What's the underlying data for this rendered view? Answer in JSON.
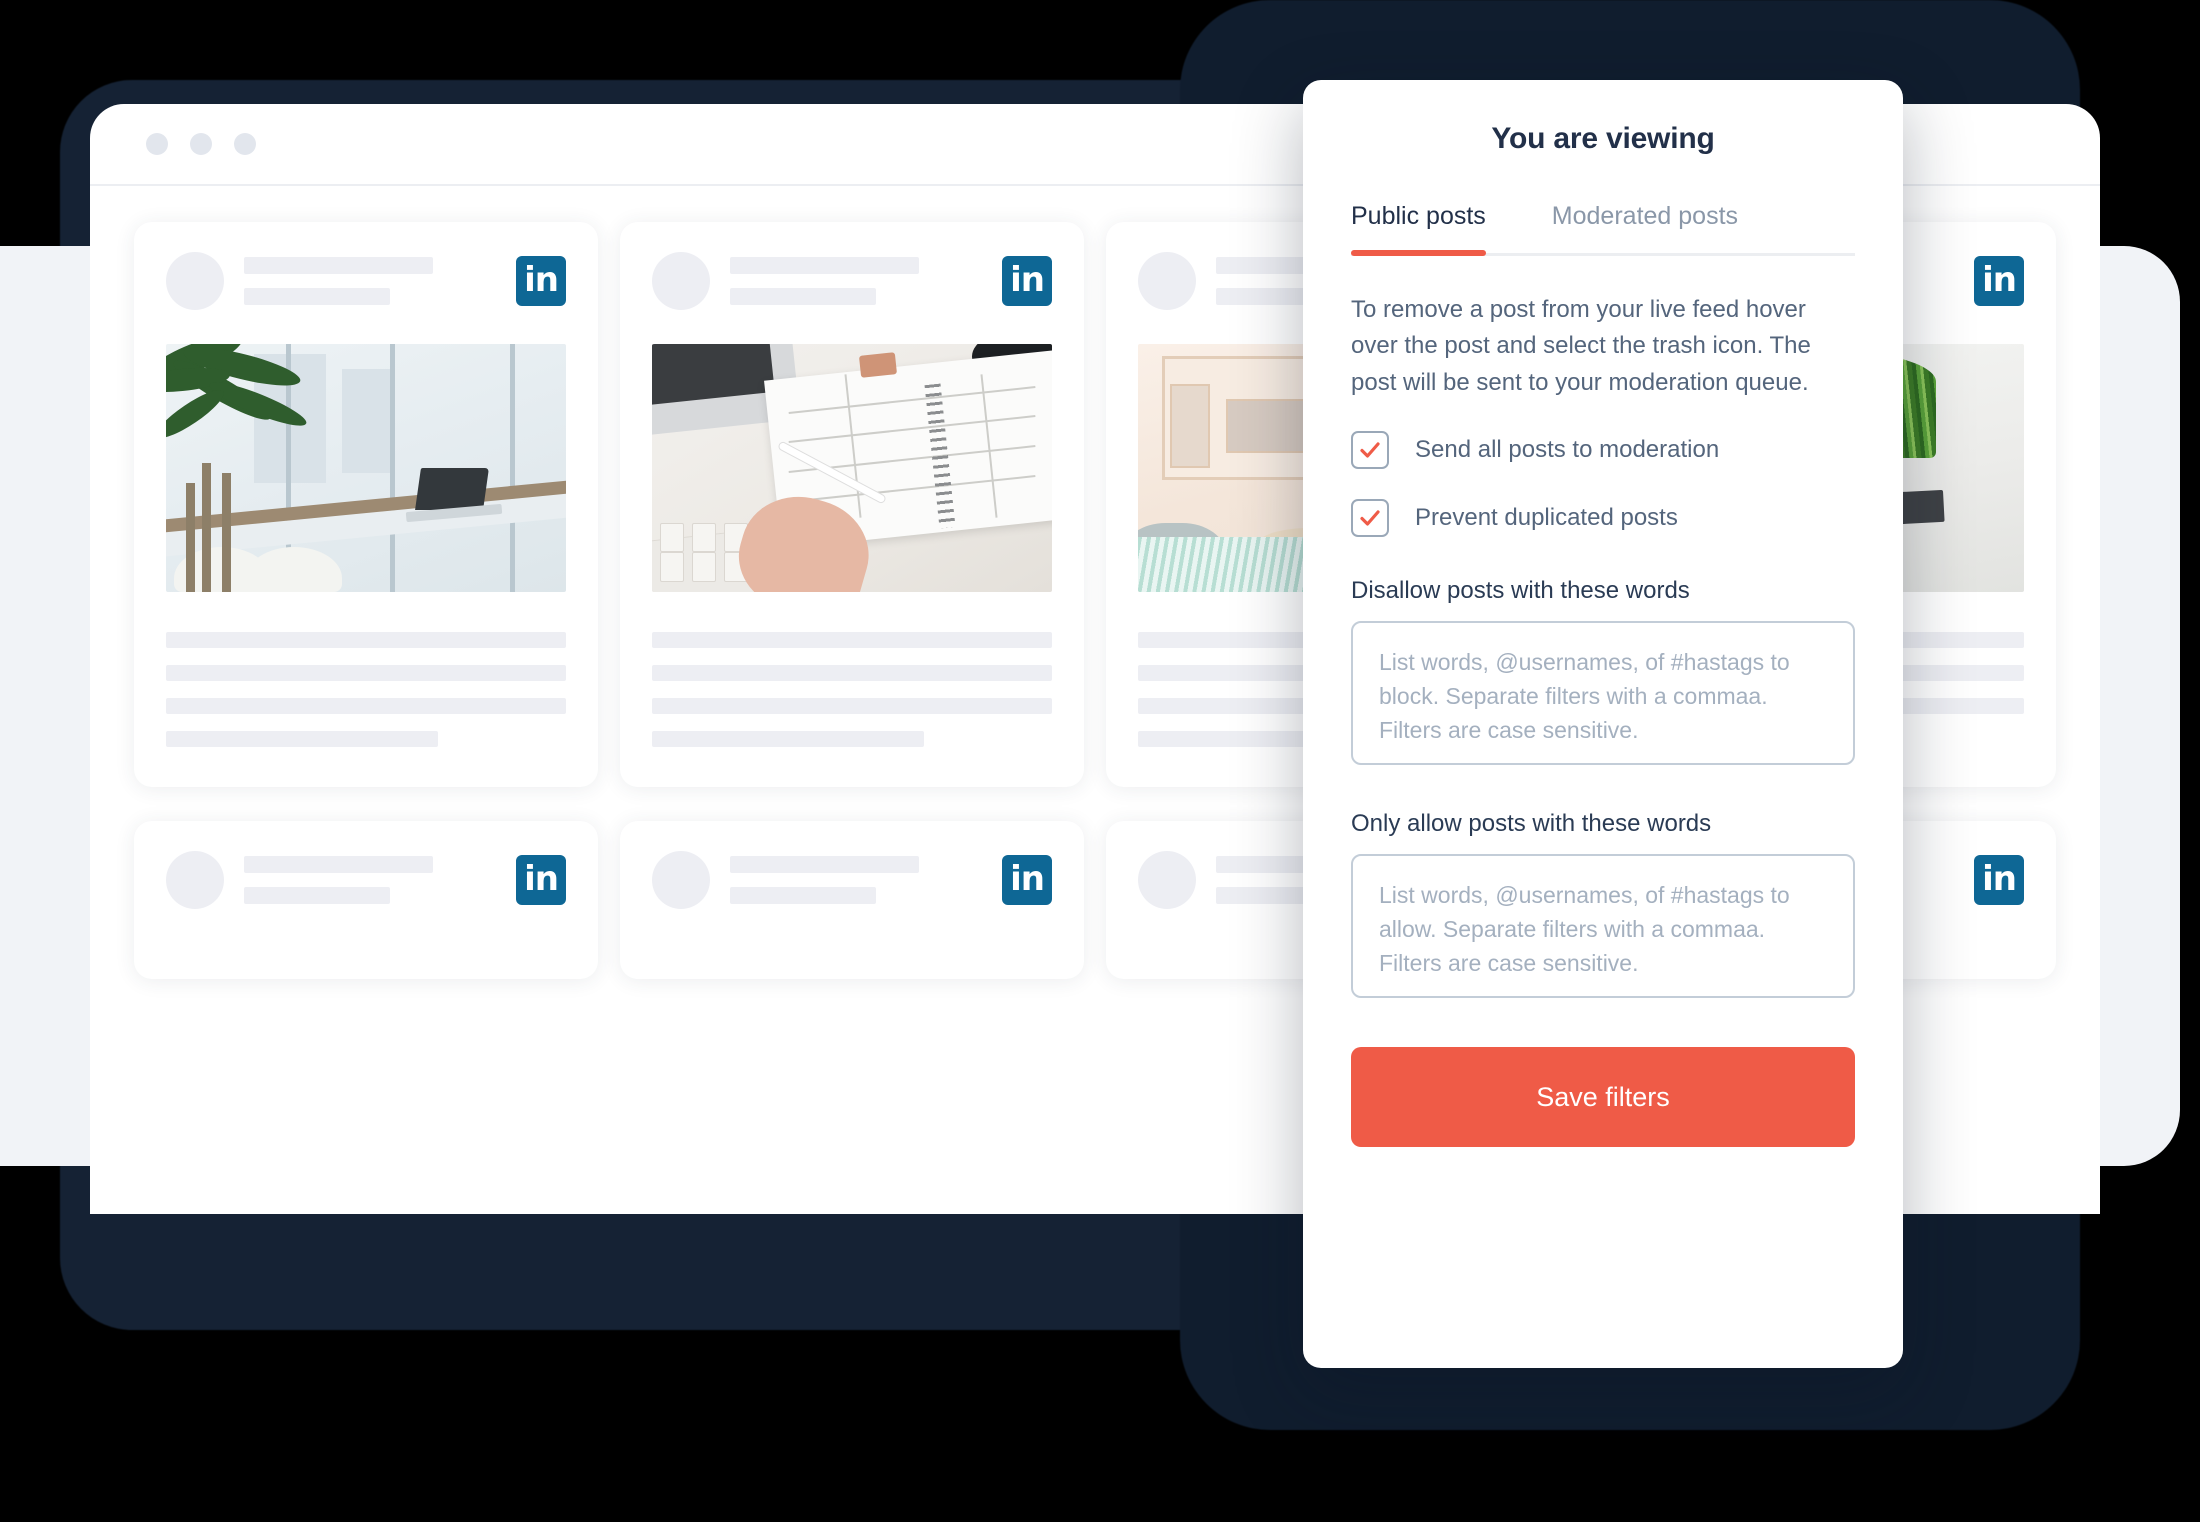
{
  "browser": {
    "window_dots": [
      "dot-1",
      "dot-2",
      "dot-3"
    ]
  },
  "feed": {
    "network_badge_text": "in",
    "network_badge_name": "linkedin-icon",
    "network_badge_color": "#0e6795",
    "cards": [
      {
        "photo": "office-window-plant",
        "has_photo": true
      },
      {
        "photo": "desk-planner-hand",
        "has_photo": true
      },
      {
        "photo": "office-lounge-chairs",
        "has_photo": true
      },
      {
        "photo": "potted-grass-desk",
        "has_photo": true
      },
      {
        "photo": "",
        "has_photo": false
      },
      {
        "photo": "",
        "has_photo": false
      },
      {
        "photo": "",
        "has_photo": false
      },
      {
        "photo": "",
        "has_photo": false
      }
    ]
  },
  "panel": {
    "title": "You are viewing",
    "tabs": [
      {
        "label": "Public posts",
        "active": true
      },
      {
        "label": "Moderated posts",
        "active": false
      }
    ],
    "description": "To remove a post from your live feed hover over the post and select the trash icon. The post will be sent to your moderation queue.",
    "checkboxes": [
      {
        "label": "Send all posts to moderation",
        "checked": true
      },
      {
        "label": "Prevent duplicated posts",
        "checked": true
      }
    ],
    "fields": [
      {
        "label": "Disallow posts with these words",
        "value": "",
        "placeholder": "List words, @usernames, of #hastags to block. Separate filters with a commaa. Filters are case sensitive."
      },
      {
        "label": "Only allow posts with these words",
        "value": "",
        "placeholder": "List words, @usernames, of #hastags to allow. Separate filters with a commaa. Filters are case sensitive."
      }
    ],
    "save_label": "Save filters",
    "accent_color": "#ef5b47"
  }
}
